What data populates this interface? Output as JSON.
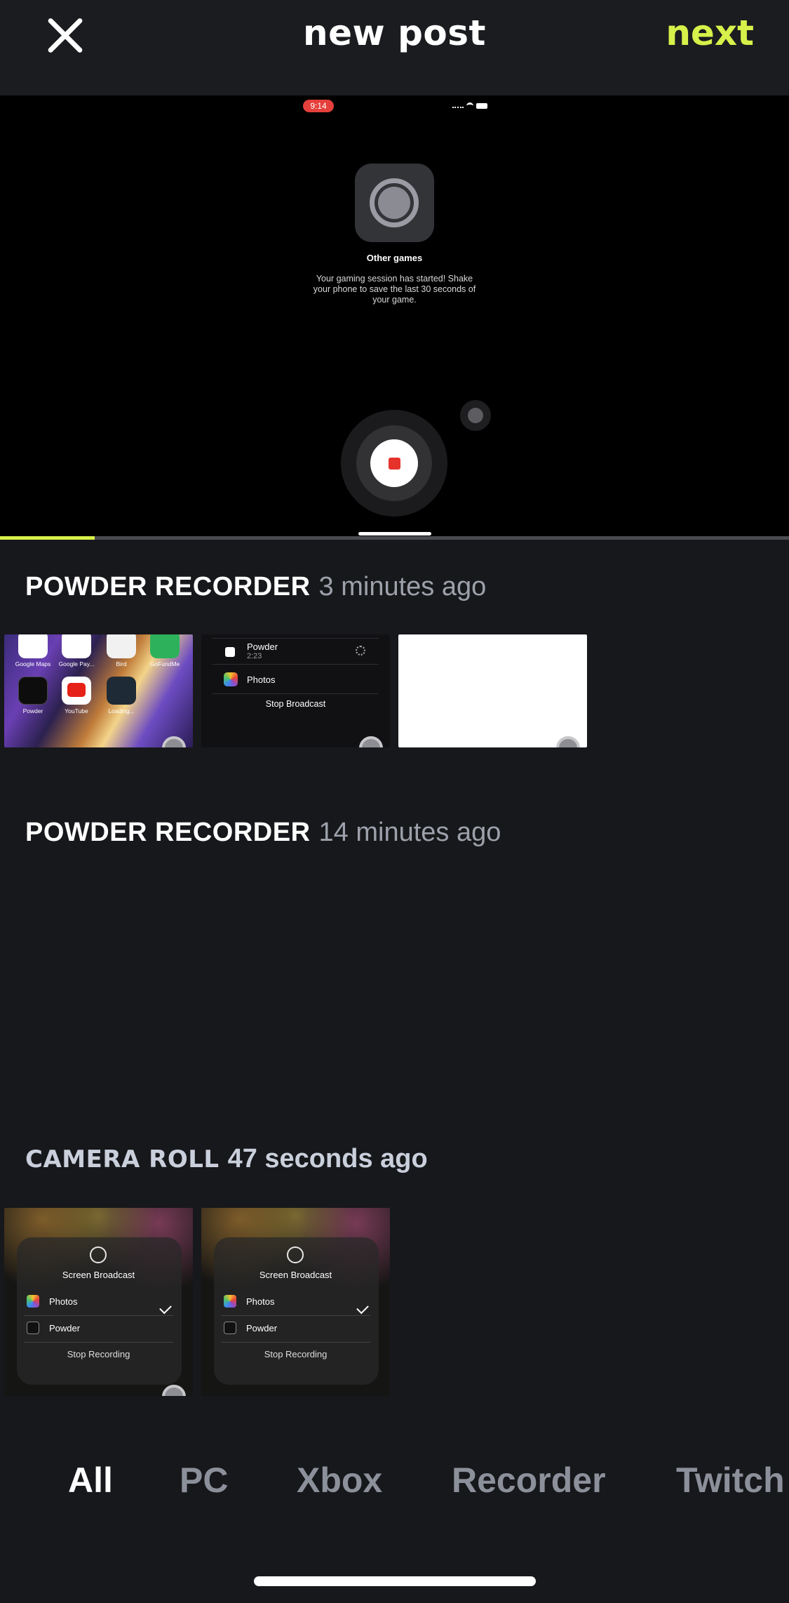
{
  "header": {
    "title": "new post",
    "next_label": "next"
  },
  "preview": {
    "status_time": "9:14",
    "game_title": "Other games",
    "game_description": "Your gaming session has started! Shake your phone to save the last 30 seconds of your game.",
    "progress_fraction": 0.12
  },
  "sections": [
    {
      "source": "POWDER RECORDER",
      "time_ago": "3 minutes ago",
      "thumbnails": [
        {
          "type": "home-screen",
          "apps": [
            "Google Maps",
            "Google Pay...",
            "Bird",
            "GoFundMe",
            "Powder",
            "YouTube",
            "Loading..."
          ]
        },
        {
          "type": "broadcast-picker",
          "rows": [
            {
              "label": "Powder",
              "sub": "2:23"
            },
            {
              "label": "Photos"
            }
          ],
          "action": "Stop Broadcast"
        },
        {
          "type": "blank"
        }
      ]
    },
    {
      "source": "POWDER RECORDER",
      "time_ago": "14 minutes ago",
      "thumbnails": []
    },
    {
      "source": "CAMERA ROLL",
      "time_ago": "47 seconds ago",
      "thumbnails": [
        {
          "type": "screen-broadcast",
          "title": "Screen Broadcast",
          "rows": [
            "Photos",
            "Powder"
          ],
          "action": "Stop Recording"
        },
        {
          "type": "screen-broadcast",
          "title": "Screen Broadcast",
          "rows": [
            "Photos",
            "Powder"
          ],
          "action": "Stop Recording"
        }
      ]
    }
  ],
  "tabs": [
    {
      "label": "All",
      "active": true
    },
    {
      "label": "PC",
      "active": false
    },
    {
      "label": "Xbox",
      "active": false
    },
    {
      "label": "Recorder",
      "active": false
    },
    {
      "label": "Twitch",
      "active": false
    }
  ],
  "colors": {
    "accent": "#d7f04a",
    "background": "#17181b",
    "record_red": "#e5322b"
  },
  "icons": {
    "close": "close-icon",
    "record": "record-icon",
    "stop": "stop-icon"
  }
}
